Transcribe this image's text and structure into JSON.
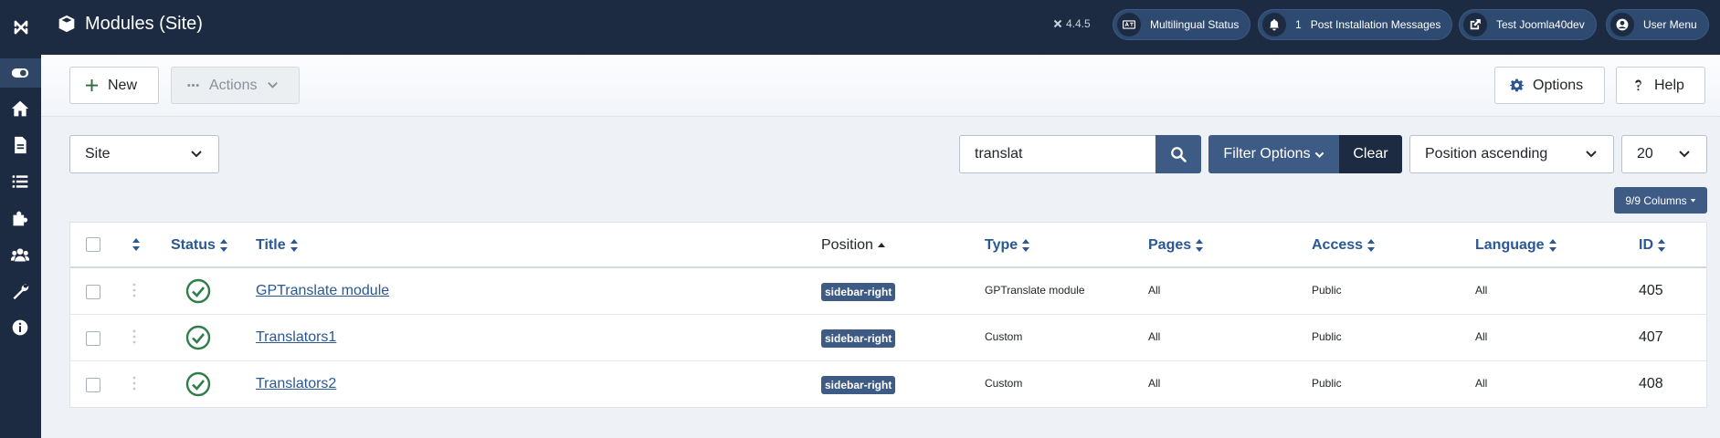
{
  "header": {
    "title": "Modules (Site)",
    "version": "4.4.5",
    "buttons": [
      {
        "label": "Multilingual Status",
        "icon": "language-icon"
      },
      {
        "label": "Post Installation Messages",
        "count": "1",
        "icon": "bell-icon"
      },
      {
        "label": "Test Joomla40dev",
        "icon": "external-link-icon"
      },
      {
        "label": "User Menu",
        "icon": "user-icon"
      }
    ]
  },
  "sidebar": {
    "items": [
      "toggle-menu-icon",
      "home-icon",
      "content-icon",
      "menus-icon",
      "components-icon",
      "users-icon",
      "system-icon",
      "help-info-icon"
    ]
  },
  "toolbar": {
    "new_label": "New",
    "actions_label": "Actions",
    "options_label": "Options",
    "help_label": "Help"
  },
  "filters": {
    "client": "Site",
    "search_value": "translat",
    "filter_options_label": "Filter Options",
    "clear_label": "Clear",
    "ordering": "Position ascending",
    "limit": "20",
    "columns_label": "9/9 Columns"
  },
  "table": {
    "headers": {
      "status": "Status",
      "title": "Title",
      "position": "Position",
      "type": "Type",
      "pages": "Pages",
      "access": "Access",
      "language": "Language",
      "id": "ID"
    },
    "rows": [
      {
        "title": "GPTranslate module",
        "position": "sidebar-right",
        "type": "GPTranslate module",
        "pages": "All",
        "access": "Public",
        "language": "All",
        "id": "405"
      },
      {
        "title": "Translators1",
        "position": "sidebar-right",
        "type": "Custom",
        "pages": "All",
        "access": "Public",
        "language": "All",
        "id": "407"
      },
      {
        "title": "Translators2",
        "position": "sidebar-right",
        "type": "Custom",
        "pages": "All",
        "access": "Public",
        "language": "All",
        "id": "408"
      }
    ]
  },
  "colors": {
    "header_bg": "#1c2b41",
    "primary": "#3e5b85",
    "link": "#2a5795",
    "published": "#2f7d4a"
  }
}
